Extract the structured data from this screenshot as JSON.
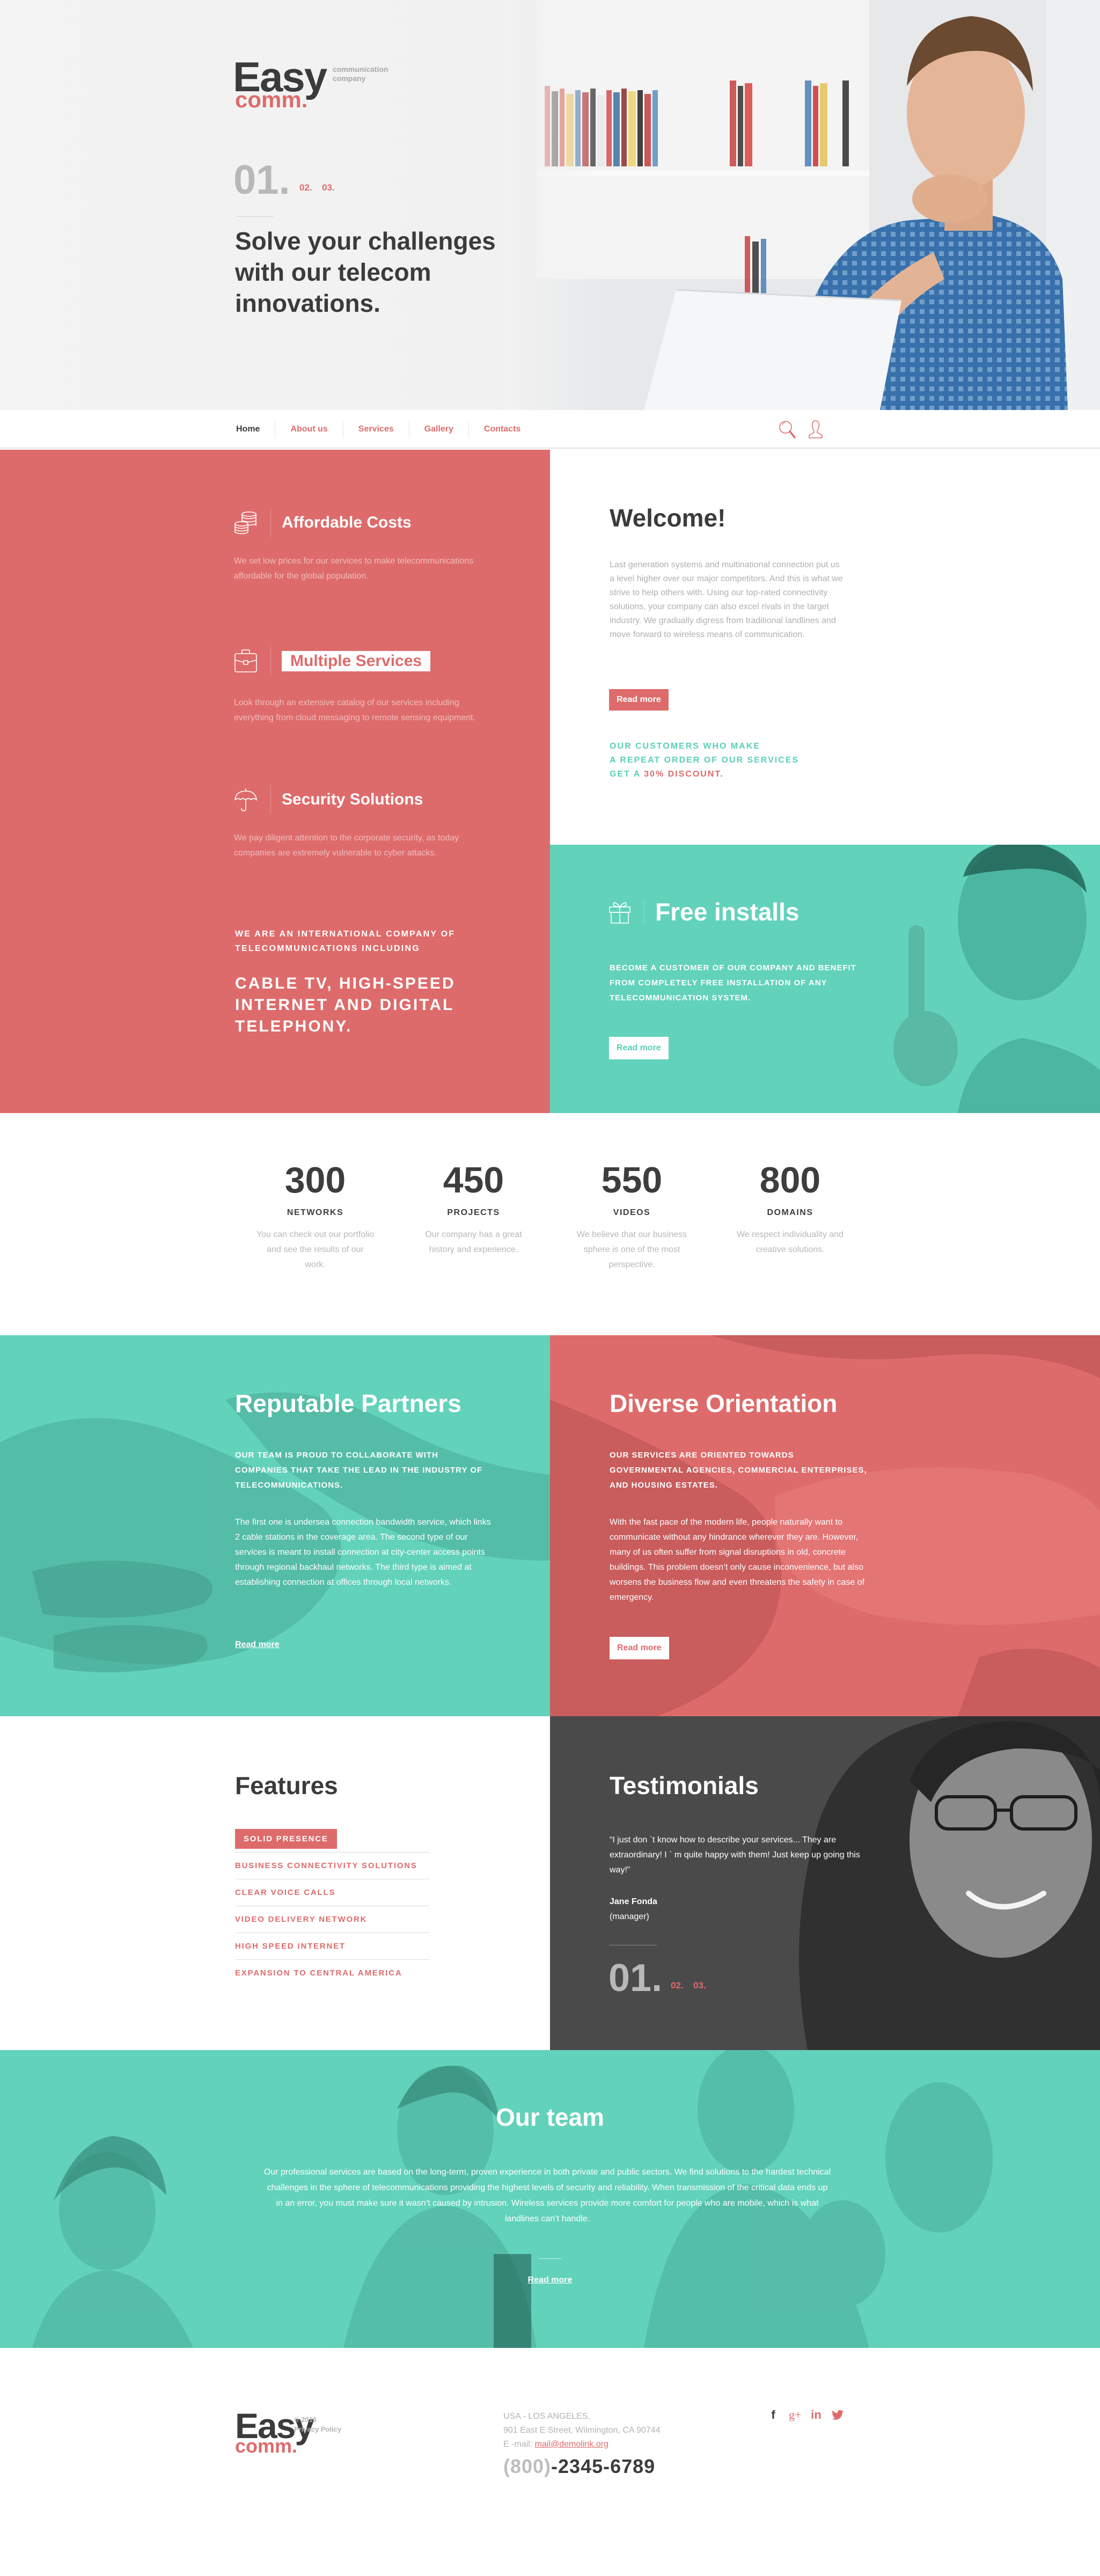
{
  "colors": {
    "coral": "#de6b6b",
    "teal": "#62d2bb",
    "dark": "#3b3b3b",
    "gray_panel": "#4a4a4a",
    "muted": "#b3b3b3"
  },
  "brand": {
    "name_top": "Easy",
    "name_bottom": "comm.",
    "tagline_1": "communication",
    "tagline_2": "company"
  },
  "hero": {
    "slide_current": "01.",
    "slides": [
      "02.",
      "03."
    ],
    "title": "Solve your challenges with our telecom innovations."
  },
  "nav": {
    "items": [
      "Home",
      "About us",
      "Services",
      "Gallery",
      "Contacts"
    ],
    "active": "Home",
    "icons": [
      "search-icon",
      "user-icon"
    ]
  },
  "features_block": {
    "items": [
      {
        "icon": "coins-icon",
        "title": "Affordable Costs",
        "text": "We set low prices for our services to make telecommunications affordable for the global population."
      },
      {
        "icon": "briefcase-icon",
        "title": "Multiple Services",
        "text": "Look through an extensive catalog of our services including everything from cloud messaging to remote sensing equipment."
      },
      {
        "icon": "umbrella-icon",
        "title": "Security Solutions",
        "text": "We pay diligent attention to the corporate security, as today companies are extremely vulnerable to cyber attacks."
      }
    ],
    "intl_small": "WE ARE AN INTERNATIONAL COMPANY OF TELECOMMUNICATIONS INCLUDING",
    "intl_large": "CABLE TV, HIGH-SPEED INTERNET AND DIGITAL TELEPHONY."
  },
  "welcome": {
    "title": "Welcome!",
    "text": "Last generation systems and multinational connection put us a level higher over our major competitors. And this is what we strive to help others with. Using our top-rated connectivity solutions, your company can also excel rivals in the target industry.  We gradually digress from traditional landlines and move forward to wireless means of communication.",
    "button": "Read more",
    "discount_1": "OUR CUSTOMERS WHO MAKE",
    "discount_2": "A REPEAT ORDER OF OUR SERVICES",
    "discount_3a": "GET A ",
    "discount_3b": "30% DISCOUNT."
  },
  "free_installs": {
    "icon": "gift-icon",
    "title": "Free installs",
    "text": "BECOME A CUSTOMER OF OUR COMPANY AND BENEFIT FROM COMPLETELY FREE INSTALLATION OF ANY TELECOMMUNICATION SYSTEM.",
    "button": "Read more"
  },
  "stats": [
    {
      "number": "300",
      "label": "NETWORKS",
      "text": "You can check out our portfolio and see the results of our work."
    },
    {
      "number": "450",
      "label": "PROJECTS",
      "text": "Our company has a great history and experience."
    },
    {
      "number": "550",
      "label": "VIDEOS",
      "text": "We believe that our business sphere is one of the most perspective."
    },
    {
      "number": "800",
      "label": "DOMAINS",
      "text": "We respect individuality and creative solutions."
    }
  ],
  "partners": {
    "title": "Reputable Partners",
    "subtitle": "OUR TEAM IS PROUD TO COLLABORATE WITH COMPANIES THAT TAKE THE LEAD IN THE INDUSTRY OF TELECOMMUNICATIONS.",
    "text": "The first one is undersea connection bandwidth service, which links 2 cable stations in the coverage area. The second type of our services is meant to install connection at city-center access points through regional backhaul networks. The third type is aimed at establishing connection at offices through local networks.",
    "link": "Read more"
  },
  "orientation": {
    "title": "Diverse Orientation",
    "subtitle": "OUR SERVICES ARE ORIENTED TOWARDS GOVERNMENTAL AGENCIES, COMMERCIAL ENTERPRISES, AND HOUSING ESTATES.",
    "text": "With the fast pace of the modern life, people naturally want to communicate without any hindrance wherever they are. However, many of us often suffer from signal disruptions in old, concrete buildings. This problem doesn’t only cause inconvenience, but also worsens the business flow and even threatens the safety in case of emergency.",
    "button": "Read more"
  },
  "features_list": {
    "title": "Features",
    "items": [
      "SOLID PRESENCE",
      "BUSINESS CONNECTIVITY SOLUTIONS",
      "CLEAR VOICE CALLS",
      "VIDEO DELIVERY NETWORK",
      "HIGH SPEED INTERNET",
      "EXPANSION TO CENTRAL AMERICA"
    ],
    "active_index": 0
  },
  "testimonials": {
    "title": "Testimonials",
    "quote": "“I just don `t know how to describe your services... They are extraordinary! I ` m quite happy with them! Just keep up going this way!”",
    "name": "Jane Fonda",
    "role": "(manager)",
    "slide_current": "01.",
    "slides": [
      "02.",
      "03."
    ]
  },
  "team": {
    "title": "Our team",
    "text": "Our professional services are based on the long-term, proven experience in both private and public sectors. We find solutions to the hardest technical challenges in the sphere of telecommunications providing the highest levels of security and reliability. When transmission of the critical data ends up in an error, you must make sure it wasn’t caused by intrusion. Wireless services provide more comfort for people who are mobile, which is what landlines can’t handle.",
    "link": "Read more"
  },
  "footer": {
    "copyright": "© 2016",
    "privacy": "Privacy Policy",
    "address_1": "USA - LOS ANGELES,",
    "address_2": "901 East E Street, Wilmington, CA 90744",
    "email_label": "E -mail: ",
    "email": "mail@demolink.org",
    "phone_code": "(800)",
    "phone_number": "-2345-6789",
    "social": [
      {
        "name": "facebook",
        "glyph": "f"
      },
      {
        "name": "google-plus",
        "glyph": "g+"
      },
      {
        "name": "linkedin",
        "glyph": "in"
      },
      {
        "name": "twitter",
        "glyph": "🐦"
      }
    ]
  }
}
